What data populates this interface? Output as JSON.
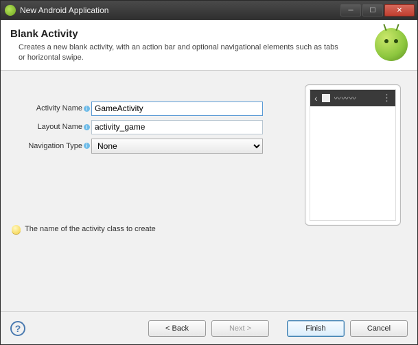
{
  "titlebar": {
    "text": "New Android Application"
  },
  "header": {
    "title": "Blank Activity",
    "description": "Creates a new blank activity, with an action bar and optional navigational elements such as tabs or horizontal swipe."
  },
  "form": {
    "activity_name": {
      "label": "Activity Name",
      "value": "GameActivity"
    },
    "layout_name": {
      "label": "Layout Name",
      "value": "activity_game"
    },
    "navigation_type": {
      "label": "Navigation Type",
      "selected": "None",
      "options": [
        "None"
      ]
    }
  },
  "hint": {
    "text": "The name of the activity class to create"
  },
  "footer": {
    "back": "< Back",
    "next": "Next >",
    "finish": "Finish",
    "cancel": "Cancel"
  }
}
